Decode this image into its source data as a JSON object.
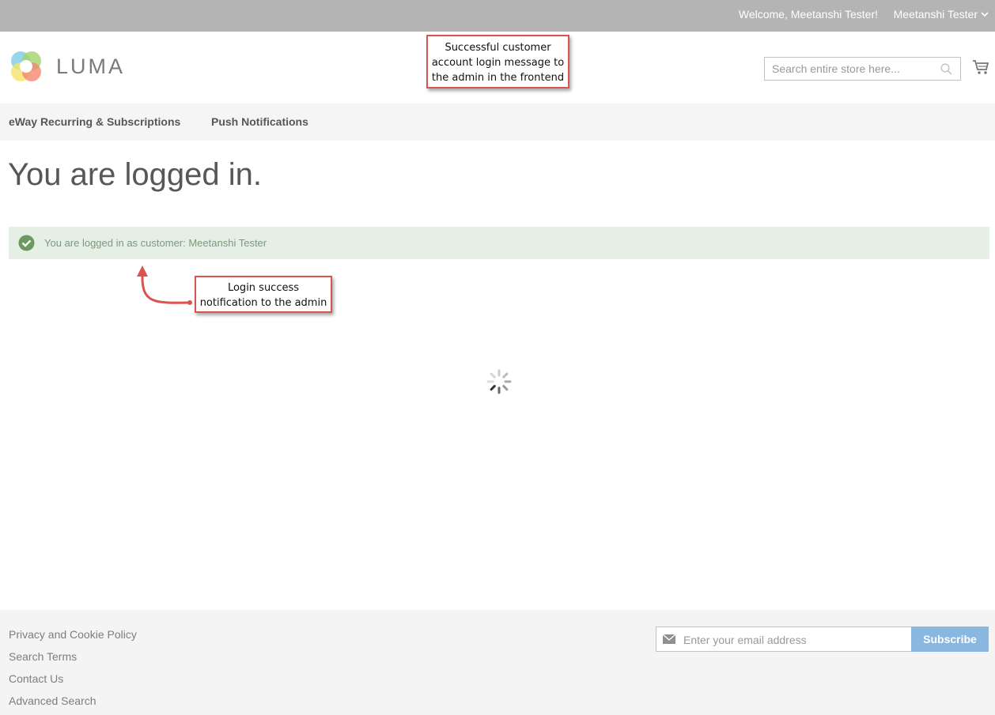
{
  "topbar": {
    "welcome": "Welcome, Meetanshi Tester!",
    "account_name": "Meetanshi Tester",
    "dropdown_icon": "chevron-down-icon"
  },
  "header": {
    "logo_text": "LUMA",
    "search_placeholder": "Search entire store here...",
    "search_icon": "search-icon",
    "cart_icon": "cart-icon"
  },
  "nav": {
    "items": [
      {
        "label": "eWay Recurring & Subscriptions"
      },
      {
        "label": "Push Notifications"
      }
    ]
  },
  "main": {
    "title": "You are logged in.",
    "message": "You are logged in as customer: Meetanshi Tester",
    "message_icon": "check-circle-icon",
    "loading_icon": "spinner-icon"
  },
  "annotations": {
    "top": [
      "Successful customer",
      "account login message to",
      "the admin in the frontend"
    ],
    "mid": [
      "Login success",
      "notification to the admin"
    ]
  },
  "footer": {
    "links": [
      "Privacy and Cookie Policy",
      "Search Terms",
      "Contact Us",
      "Advanced Search"
    ],
    "newsletter_placeholder": "Enter your email address",
    "subscribe_label": "Subscribe"
  },
  "colors": {
    "topbar": "#b4b4b4",
    "message_bg": "#e5efe5",
    "success_green": "#6a9a5f",
    "annotation_red": "#d9534f",
    "subscribe_blue": "#8ab7e0"
  }
}
